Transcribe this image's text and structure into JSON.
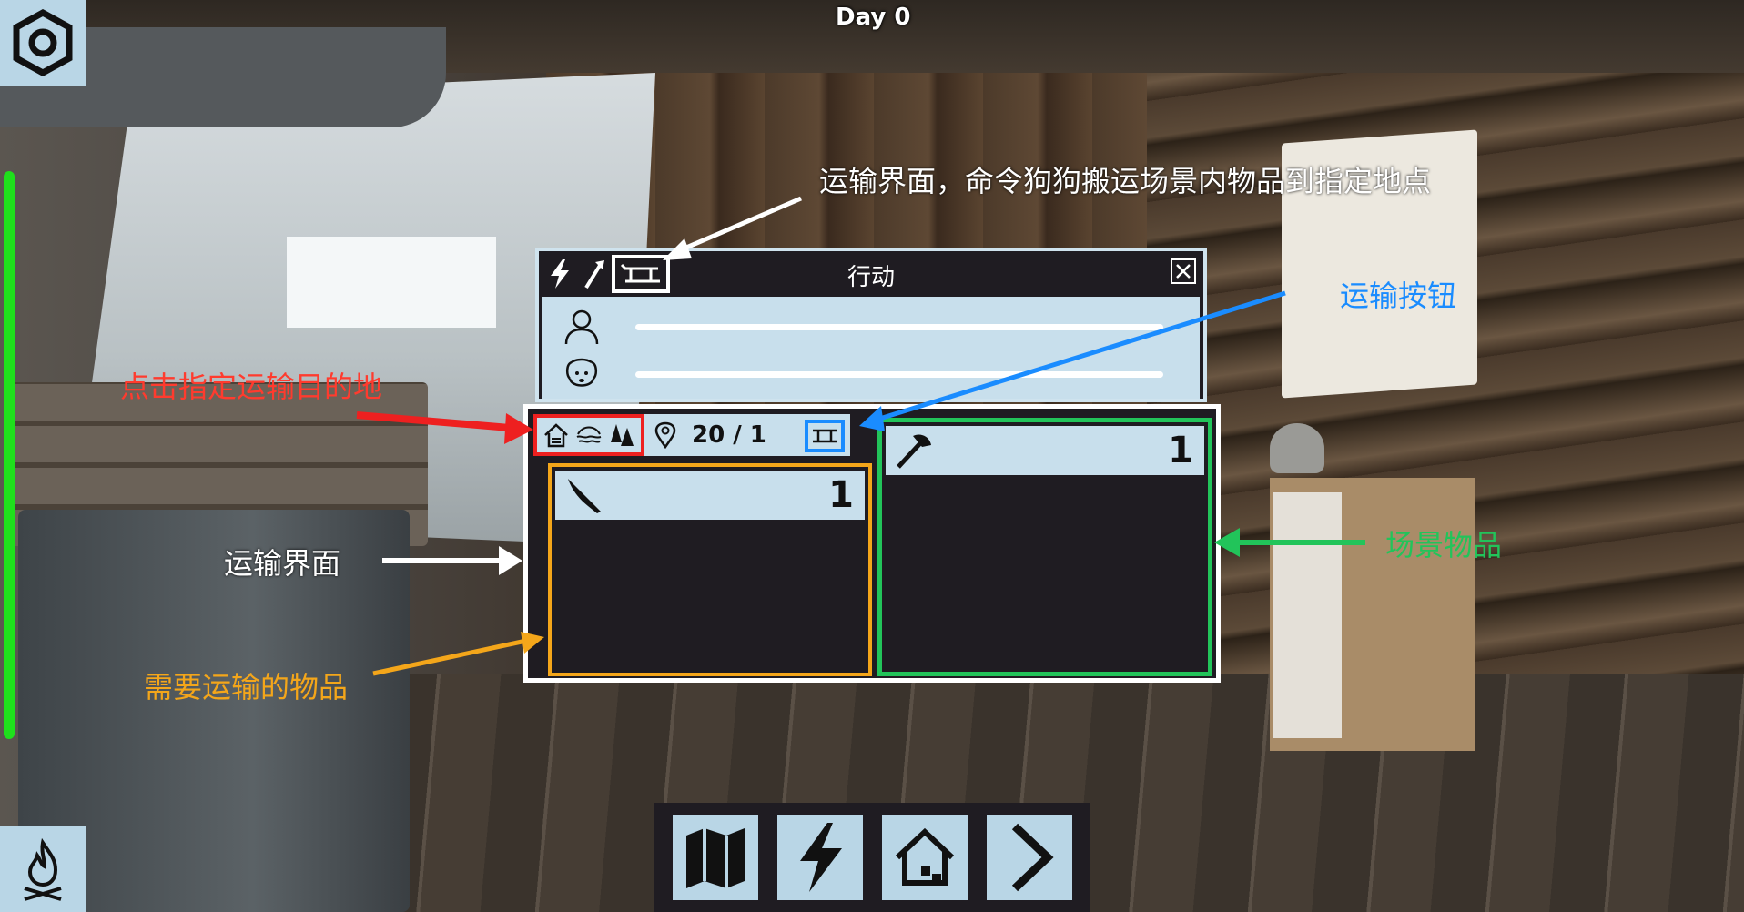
{
  "hud": {
    "day_label": "Day 0",
    "health_color": "#1fe01c",
    "settings_icon": "gear-hex-icon",
    "fire_icon": "campfire-icon"
  },
  "bottom_bar": {
    "buttons": [
      {
        "icon": "map-icon"
      },
      {
        "icon": "lightning-icon"
      },
      {
        "icon": "home-icon"
      },
      {
        "icon": "chevron-right-icon"
      }
    ]
  },
  "action_dialog": {
    "title": "行动",
    "tabs": [
      "lightning-icon",
      "axe-icon",
      "sled-icon"
    ],
    "active_tab": "sled-icon",
    "status_rows": [
      "person-icon",
      "dog-icon"
    ]
  },
  "transport_panel": {
    "destinations": [
      "house-icon",
      "lake-icon",
      "forest-icon"
    ],
    "capacity": "20 / 1",
    "transport_items": [
      {
        "icon": "knife-icon",
        "qty": "1"
      }
    ],
    "scene_items": [
      {
        "icon": "axe-icon",
        "qty": "1"
      }
    ]
  },
  "annotations": {
    "transport_ui_command": "运输界面，命令狗狗搬运场景内物品到指定地点",
    "transport_button": "运输按钮",
    "click_destination": "点击指定运输目的地",
    "transport_ui": "运输界面",
    "scene_items": "场景物品",
    "items_to_transport": "需要运输的物品"
  },
  "colors": {
    "panel_bg": "#1f1c22",
    "panel_light": "#c8dfec",
    "red": "#ee2020",
    "blue": "#1a8cff",
    "orange": "#f4a61a",
    "green": "#22c45a"
  }
}
